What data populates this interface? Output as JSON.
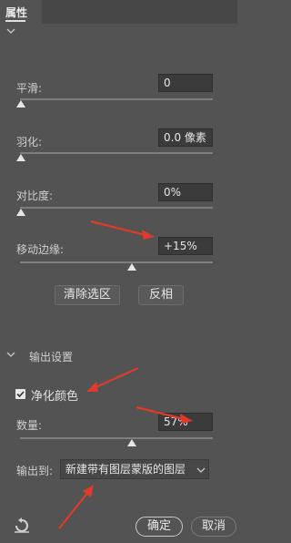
{
  "panel": {
    "title": "属性"
  },
  "fields": {
    "smooth": {
      "label": "平滑:",
      "value": "0",
      "slider": 0.0
    },
    "feather": {
      "label": "羽化:",
      "value": "0.0 像素",
      "slider": 0.0
    },
    "contrast": {
      "label": "对比度:",
      "value": "0%",
      "slider": 0.0
    },
    "shift_edge": {
      "label": "移动边缘:",
      "value": "+15%",
      "slider": 0.57
    }
  },
  "buttons": {
    "clear_selection": "清除选区",
    "invert": "反相",
    "ok": "确定",
    "cancel": "取消"
  },
  "output": {
    "section_title": "输出设置",
    "decontaminate": {
      "label": "净化颜色",
      "checked": true
    },
    "amount": {
      "label": "数量:",
      "value": "57%",
      "slider": 0.57
    },
    "output_to": {
      "label": "输出到:",
      "selected": "新建带有图层蒙版的图层"
    }
  },
  "colors": {
    "background": "#535353",
    "annotation_arrow": "#e03a2a"
  }
}
